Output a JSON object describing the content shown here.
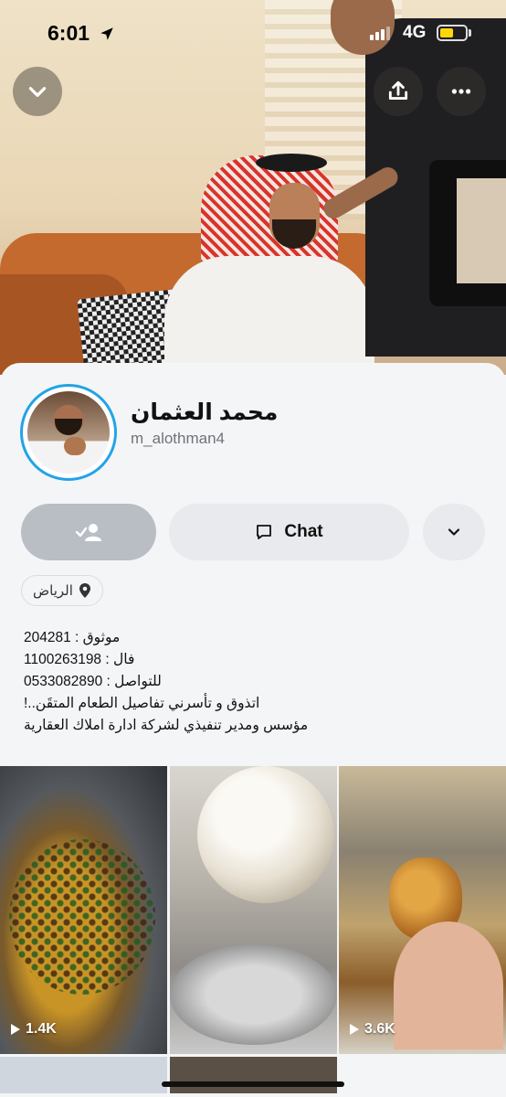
{
  "status_bar": {
    "time": "6:01",
    "network": "4G"
  },
  "profile": {
    "display_name": "محمد العثمان",
    "username": "m_alothman4"
  },
  "actions": {
    "chat_label": "Chat"
  },
  "location": {
    "label": "الرياض"
  },
  "bio": [
    "موثوق : 204281",
    "فال : 1100263198",
    "للتواصل : 0533082890",
    "اتذوق و تأسرني تفاصيل الطعام المتقَن..!",
    "مؤسس ومدير تنفيذي لشركة ادارة املاك العقارية"
  ],
  "stories": [
    {
      "views": "1.4K"
    },
    {
      "views": ""
    },
    {
      "views": "3.6K"
    }
  ],
  "colors": {
    "story_ring": "#23a3e6",
    "battery": "#ffd60a"
  }
}
